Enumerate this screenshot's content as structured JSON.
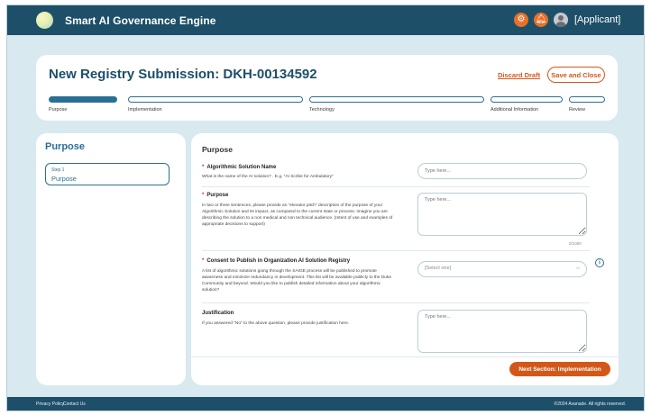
{
  "app": {
    "title": "Smart AI Governance Engine",
    "user_role": "[Applicant]"
  },
  "icons": {
    "logo": "sphere-logo-icon",
    "settings": "gear-icon",
    "notifications": "bell-icon",
    "avatar": "user-avatar-icon",
    "info": "info-icon",
    "dropdown": "chevron-down-icon"
  },
  "colors": {
    "primary": "#1d4f68",
    "accent": "#d2581a",
    "step_active": "#2a6f93",
    "background": "#d8e9ef",
    "required": "#d9302c"
  },
  "header": {
    "page_title": "New Registry Submission: DKH-00134592",
    "discard_label": "Discard Draft",
    "save_close_label": "Save and Close"
  },
  "steps": [
    {
      "label": "Purpose",
      "active": true
    },
    {
      "label": "Implementation",
      "active": false
    },
    {
      "label": "Technology",
      "active": false
    },
    {
      "label": "Additional Information",
      "active": false
    },
    {
      "label": "Review",
      "active": false
    }
  ],
  "sidebar": {
    "title": "Purpose",
    "step_small": "Step 1",
    "step_name": "Purpose"
  },
  "main": {
    "section_title": "Purpose",
    "questions": {
      "name": {
        "title": "Algorithmic Solution Name",
        "description": "What is the name of the AI solution? . E.g. \"AI Scribe for Ambulatory\"",
        "placeholder": "Type here..."
      },
      "purpose": {
        "title": "Purpose",
        "description": "In two or three sentences, please provide an \"elevator pitch\" description of the purpose of your Algorithmic Solution and its impact, as compared to the current state or process. Imagine you are describing the solution to a non medical and non technical audience. (Intent of use and examples of appropriate decisions to support)",
        "placeholder": "Type here...",
        "counter": "0/1000"
      },
      "consent": {
        "title": "Consent to Publish in Organization AI Solution Registry",
        "description": "A list of algorithmic solutions going through the SAIGE process will be published to promote awareness and minimize redundancy in development. This list will be available publicly to the Duke Community and beyond. Would you like to publish detailed information about your algorithmic solution?",
        "select_value": "[Select one]"
      },
      "justification": {
        "title": "Justification",
        "description": "If you answered \"No\" to the above question, please provide justification here.",
        "placeholder": "Type here..."
      }
    },
    "next_label": "Next Section: Implementation"
  },
  "footer": {
    "privacy": "Privacy Policy",
    "contact": "Contact Us",
    "copyright": "©2024 Avanade. All rights reserved."
  }
}
